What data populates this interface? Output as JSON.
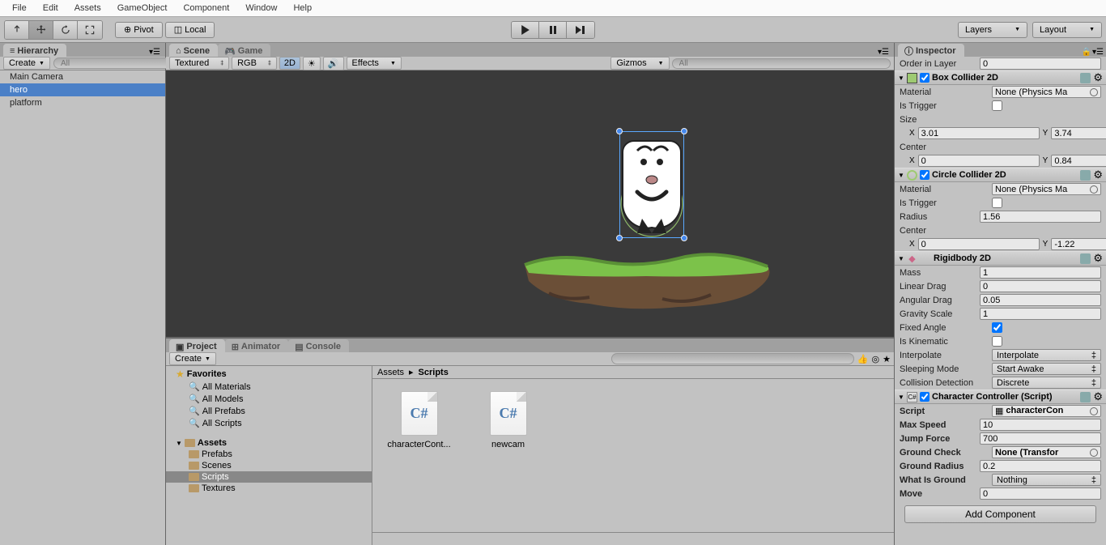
{
  "menu": [
    "File",
    "Edit",
    "Assets",
    "GameObject",
    "Component",
    "Window",
    "Help"
  ],
  "toolbar": {
    "pivot": "Pivot",
    "local": "Local",
    "layers": "Layers",
    "layout": "Layout"
  },
  "hierarchy": {
    "title": "Hierarchy",
    "create": "Create",
    "items": [
      "Main Camera",
      "hero",
      "platform"
    ],
    "selected": "hero",
    "search_ph": "All"
  },
  "scene": {
    "tab_scene": "Scene",
    "tab_game": "Game",
    "shading": "Textured",
    "render": "RGB",
    "btn_2d": "2D",
    "effects": "Effects",
    "gizmos": "Gizmos",
    "search_ph": "All"
  },
  "project": {
    "tab_project": "Project",
    "tab_animator": "Animator",
    "tab_console": "Console",
    "create": "Create",
    "favorites": "Favorites",
    "fav_items": [
      "All Materials",
      "All Models",
      "All Prefabs",
      "All Scripts"
    ],
    "assets": "Assets",
    "folders": [
      "Prefabs",
      "Scenes",
      "Scripts",
      "Textures"
    ],
    "selected_folder": "Scripts",
    "crumb1": "Assets",
    "crumb_sep": "▸",
    "crumb2": "Scripts",
    "files": [
      {
        "name": "characterCont...",
        "type": "cs"
      },
      {
        "name": "newcam",
        "type": "cs"
      }
    ]
  },
  "inspector": {
    "title": "Inspector",
    "order_label": "Order in Layer",
    "order_val": "0",
    "box": {
      "title": "Box Collider 2D",
      "material": "Material",
      "material_val": "None (Physics Ma",
      "trigger": "Is Trigger",
      "size": "Size",
      "size_x": "3.01",
      "size_y": "3.74",
      "center": "Center",
      "center_x": "0",
      "center_y": "0.84"
    },
    "circle": {
      "title": "Circle Collider 2D",
      "material": "Material",
      "material_val": "None (Physics Ma",
      "trigger": "Is Trigger",
      "radius": "Radius",
      "radius_val": "1.56",
      "center": "Center",
      "center_x": "0",
      "center_y": "-1.22"
    },
    "rigid": {
      "title": "Rigidbody 2D",
      "mass": "Mass",
      "mass_v": "1",
      "ldrag": "Linear Drag",
      "ldrag_v": "0",
      "adrag": "Angular Drag",
      "adrag_v": "0.05",
      "grav": "Gravity Scale",
      "grav_v": "1",
      "fixed": "Fixed Angle",
      "kinem": "Is Kinematic",
      "interp": "Interpolate",
      "interp_v": "Interpolate",
      "sleep": "Sleeping Mode",
      "sleep_v": "Start Awake",
      "coll": "Collision Detection",
      "coll_v": "Discrete"
    },
    "script": {
      "title": "Character Controller (Script)",
      "script_l": "Script",
      "script_v": "characterCon",
      "maxspeed": "Max Speed",
      "maxspeed_v": "10",
      "jump": "Jump Force",
      "jump_v": "700",
      "ground": "Ground Check",
      "ground_v": "None (Transfor",
      "gradius": "Ground Radius",
      "gradius_v": "0.2",
      "whatground": "What Is Ground",
      "whatground_v": "Nothing",
      "move": "Move",
      "move_v": "0"
    },
    "add_comp": "Add Component"
  }
}
